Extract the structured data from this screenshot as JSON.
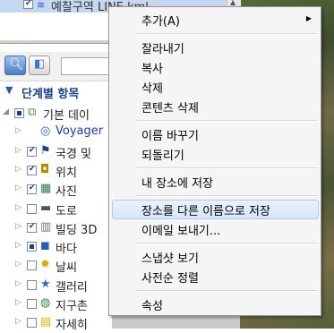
{
  "top_item": {
    "label": "예찰구역 LINE.kml",
    "icon": "file-layer-icon",
    "checked": true
  },
  "search": {
    "search_icon": "search-icon",
    "view_icon": "panel-view-icon",
    "input_value": ""
  },
  "tree": {
    "header": "단계별 항목",
    "items": [
      {
        "label": "기본 데이",
        "icon": "layers-icon",
        "checkbox": "partial",
        "expanded": true
      },
      {
        "label": "Voyager",
        "icon": "voyager-icon",
        "checkbox": "none",
        "link": true
      },
      {
        "label": "국경 및",
        "icon": "flag-icon",
        "checkbox": "checked"
      },
      {
        "label": "위치",
        "icon": "place-icon",
        "checkbox": "checked"
      },
      {
        "label": "사진",
        "icon": "photo-icon",
        "checkbox": "checked"
      },
      {
        "label": "도로",
        "icon": "road-icon",
        "checkbox": "unchecked"
      },
      {
        "label": "빌딩 3D",
        "icon": "building-icon",
        "checkbox": "checked"
      },
      {
        "label": "바다",
        "icon": "ocean-icon",
        "checkbox": "partial"
      },
      {
        "label": "날씨",
        "icon": "weather-icon",
        "checkbox": "unchecked"
      },
      {
        "label": "갤러리",
        "icon": "gallery-star-icon",
        "checkbox": "unchecked"
      },
      {
        "label": "지구촌 ",
        "icon": "globe-icon",
        "checkbox": "unchecked"
      },
      {
        "label": "자세히",
        "icon": "more-info-icon",
        "checkbox": "unchecked"
      }
    ]
  },
  "context_menu": {
    "items": [
      {
        "label": "추가(A)",
        "submenu": true
      },
      {
        "label": "잘라내기"
      },
      {
        "label": "복사"
      },
      {
        "label": "삭제"
      },
      {
        "label": "콘텐츠 삭제"
      },
      {
        "label": "이름 바꾸기"
      },
      {
        "label": "되돌리기"
      },
      {
        "label": "내 장소에 저장"
      },
      {
        "label": "장소를 다른 이름으로 저장",
        "highlighted": true
      },
      {
        "label": "이메일 보내기..."
      },
      {
        "label": "스냅샷 보기"
      },
      {
        "label": "사전순 정렬"
      },
      {
        "label": "속성"
      }
    ]
  },
  "colors": {
    "menu_bg": "#f5f5f5",
    "highlight": "#d7e6f8",
    "tree_header": "#1d3f8f",
    "link": "#1a3ab8"
  }
}
